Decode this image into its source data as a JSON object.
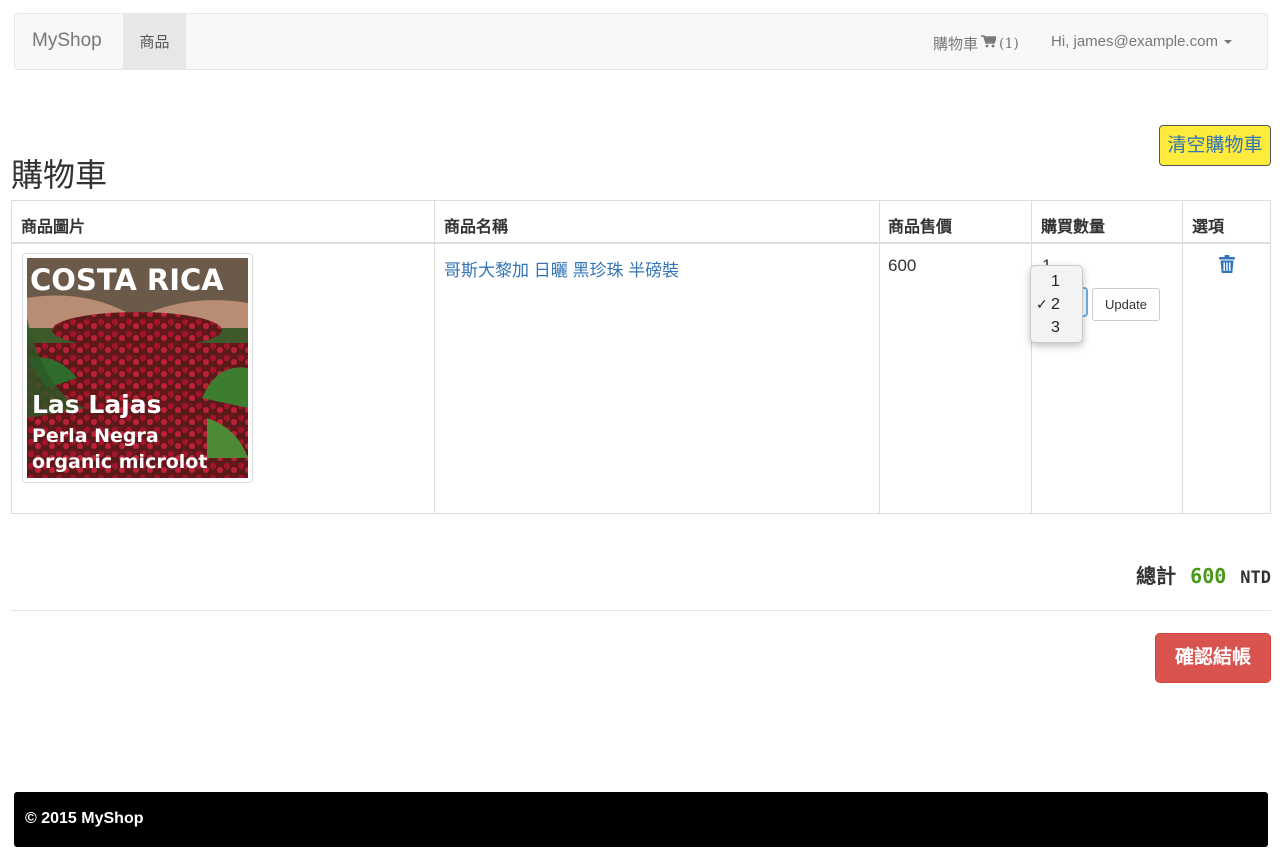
{
  "navbar": {
    "brand": "MyShop",
    "products_label": "商品",
    "cart_label": "購物車",
    "cart_count": "(1)",
    "user_label": "Hi, james@example.com"
  },
  "cart": {
    "clear_label": "清空購物車",
    "title": "購物車",
    "headers": [
      "商品圖片",
      "商品名稱",
      "商品售價",
      "購買數量",
      "選項"
    ],
    "item": {
      "image_text": [
        "COSTA RICA",
        "Las Lajas",
        "Perla Negra",
        "organic microlot"
      ],
      "name": "哥斯大黎加 日曬 黑珍珠 半磅裝",
      "price": "600",
      "quantity": "1",
      "update_label": "Update"
    },
    "quantity_options": [
      "1",
      "2",
      "3"
    ],
    "quantity_checked": "2",
    "total_label": "總計",
    "total_amount": "600",
    "currency": "NTD",
    "checkout_label": "確認結帳"
  },
  "footer": {
    "text": "© 2015 MyShop"
  },
  "colors": {
    "link": "#3374b6",
    "clear_button_bg": "#ffeb3b",
    "checkout_bg": "#d9534f",
    "total_amount": "#4a9a1a"
  }
}
